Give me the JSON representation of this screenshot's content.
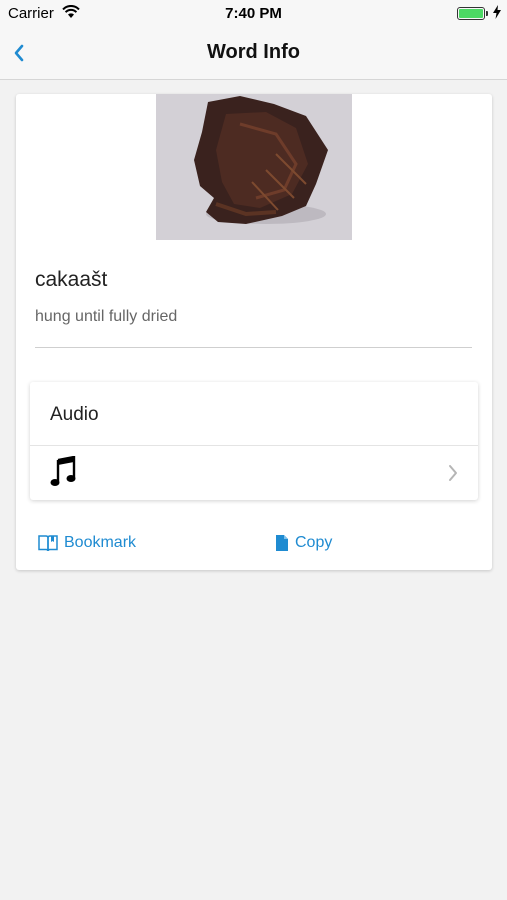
{
  "status_bar": {
    "carrier": "Carrier",
    "time": "7:40 PM",
    "battery_color": "#4cd964"
  },
  "nav": {
    "title": "Word Info",
    "back_icon": "chevron-left-icon",
    "accent": "#1f8bd1"
  },
  "word": {
    "title": "cakaašt",
    "definition": "hung until fully dried"
  },
  "audio": {
    "header": "Audio",
    "item_icon": "music-note-icon"
  },
  "actions": {
    "bookmark_label": "Bookmark",
    "copy_label": "Copy"
  }
}
